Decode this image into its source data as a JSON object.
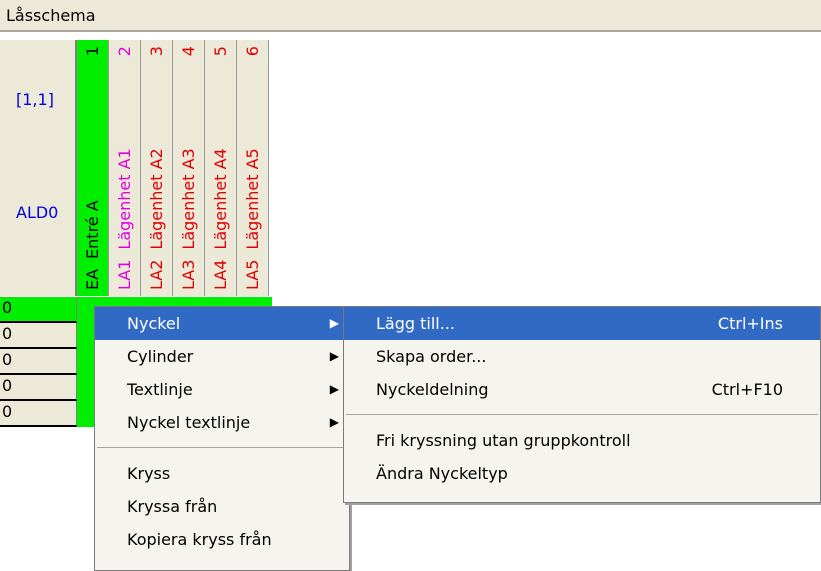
{
  "window": {
    "title": "Låsschema"
  },
  "corner": {
    "coord": "[1,1]",
    "name": "ALD0"
  },
  "columns": [
    {
      "id": "1",
      "name": "Entré A",
      "code": "EA"
    },
    {
      "id": "2",
      "name": "Lägenhet A1",
      "code": "LA1"
    },
    {
      "id": "3",
      "name": "Lägenhet A2",
      "code": "LA2"
    },
    {
      "id": "4",
      "name": "Lägenhet A3",
      "code": "LA3"
    },
    {
      "id": "5",
      "name": "Lägenhet A4",
      "code": "LA4"
    },
    {
      "id": "6",
      "name": "Lägenhet A5",
      "code": "LA5"
    }
  ],
  "rows": [
    "0",
    "0",
    "0",
    "0",
    "0"
  ],
  "context_menu": {
    "items": [
      {
        "label": "Nyckel",
        "submenu": true
      },
      {
        "label": "Cylinder",
        "submenu": true
      },
      {
        "label": "Textlinje",
        "submenu": true
      },
      {
        "label": "Nyckel textlinje",
        "submenu": true
      },
      {
        "label": "Kryss"
      },
      {
        "label": "Kryssa från"
      },
      {
        "label": "Kopiera kryss från"
      }
    ]
  },
  "submenu": {
    "items": [
      {
        "label": "Lägg till...",
        "shortcut": "Ctrl+Ins"
      },
      {
        "label": "Skapa order..."
      },
      {
        "label": "Nyckeldelning",
        "shortcut": "Ctrl+F10"
      },
      {
        "label": "Fri kryssning utan gruppkontroll"
      },
      {
        "label": "Ändra Nyckeltyp"
      }
    ]
  },
  "colors": {
    "green": "#00ee00",
    "highlight": "#316ac5",
    "blue_text": "#0000e0",
    "red_text": "#e00000",
    "magenta_text": "#e000e0"
  }
}
